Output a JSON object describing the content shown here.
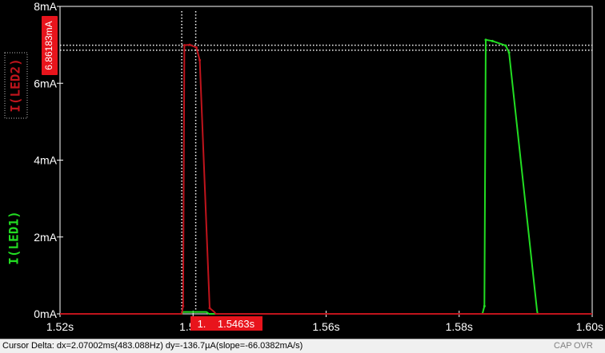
{
  "chart_data": {
    "type": "line",
    "xlabel": "",
    "ylabel": "",
    "xlim": [
      1.52,
      1.6
    ],
    "ylim": [
      0,
      8
    ],
    "x_ticks": [
      "1.52s",
      "1.54s",
      "1.56s",
      "1.58s",
      "1.60s"
    ],
    "y_ticks": [
      "0mA",
      "2mA",
      "4mA",
      "6mA",
      "8mA"
    ],
    "series": [
      {
        "name": "I(LED2)",
        "color": "#c0141c",
        "x": [
          1.52,
          1.5383,
          1.5385,
          1.5387,
          1.5395,
          1.5405,
          1.541,
          1.5425,
          1.5432,
          1.5434,
          1.6
        ],
        "y": [
          0,
          0,
          0.2,
          6.99,
          7.0,
          6.93,
          6.6,
          0.15,
          0.05,
          0,
          0
        ]
      },
      {
        "name": "I(LED1)",
        "color": "#22dd22",
        "x": [
          1.52,
          1.5383,
          1.5385,
          1.542,
          1.5424,
          1.5835,
          1.5838,
          1.584,
          1.585,
          1.587,
          1.5875,
          1.5917,
          1.5918,
          1.6
        ],
        "y": [
          0,
          0,
          0.05,
          0.05,
          0,
          0,
          0.2,
          7.13,
          7.1,
          6.98,
          6.8,
          0.1,
          0,
          0
        ]
      }
    ],
    "cursor_labels": {
      "x_cursor_left": "1.",
      "x_cursor_right": "1.5463s",
      "y_cursor": "6.86183mA"
    },
    "cursors": {
      "x1": 1.5383,
      "x2": 1.5404,
      "y1": 6.99,
      "y2": 6.86
    },
    "grid": false,
    "legend": "left-vertical"
  },
  "status": {
    "text": "Cursor Delta: dx=2.07002ms(483.088Hz)  dy=-136.7µA(slope=-66.0382mA/s)",
    "cap": "CAP",
    "ovr": "OVR",
    "num": ""
  },
  "colors": {
    "background": "#000000",
    "axis": "#ffffff",
    "cursor_box": "#e8141c",
    "led1": "#22dd22",
    "led2": "#c0141c"
  }
}
